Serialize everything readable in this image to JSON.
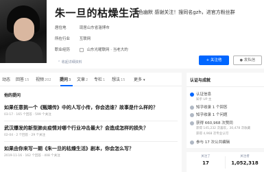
{
  "profile": {
    "name": "朱一旦的枯燥生活",
    "headline": "黑色幽默 感谢关注！搜同名gzh，进官方粉丝群",
    "rows": [
      {
        "key": "居住地",
        "value": "现居山东省淄博市"
      },
      {
        "key": "所在行业",
        "value": "互联网"
      },
      {
        "key": "职业经历",
        "value": "山东光曜联网 · 当老大的"
      }
    ],
    "collapse_label": "收起详细资料",
    "follow_label": "+ 关注他",
    "message_label": "发私信"
  },
  "tabs": [
    {
      "label": "动态",
      "count": ""
    },
    {
      "label": "回答",
      "count": "15"
    },
    {
      "label": "视频",
      "count": "202"
    },
    {
      "label": "提问",
      "count": "3"
    },
    {
      "label": "文章",
      "count": "2"
    },
    {
      "label": "专栏",
      "count": "1"
    },
    {
      "label": "想法",
      "count": "15"
    },
    {
      "label": "更多",
      "count": ""
    }
  ],
  "section_title": "他的提问",
  "questions": [
    {
      "title": "如果任意挑一个《甄嬛传》中的人写小传，你会选谁？故事是什么样的？",
      "meta": "03-17 · 165 个回答 · 599 个关注"
    },
    {
      "title": "武汉爆发的新型肺炎疫情对哪个行业冲击最大？会造成怎样的损失？",
      "meta": "02-04 · 2 个回答 · 29 个关注"
    },
    {
      "title": "如果由你来写一期《朱一旦的枯燥生活》剧本，你会怎么写？",
      "meta": "2019-11-16 · 162 个回答 · 408 个关注"
    }
  ],
  "sidebar": {
    "title": "认证与成就",
    "items": [
      {
        "label": "认证信息",
        "sub": "知乎 UP 主",
        "icon": "verified-icon"
      },
      {
        "label": "知乎收录 1 个回答",
        "sub": "",
        "icon": "collection-icon"
      },
      {
        "label": "知乎收录 1 个问题",
        "sub": "",
        "icon": "collection-icon"
      },
      {
        "label": "获得 660,968 次赞同",
        "sub": "获得 145,232 次喜欢，30,478 次收藏",
        "icon": "like-icon"
      },
      {
        "label": "",
        "sub": "获得 4,968 次专业认可",
        "icon": ""
      },
      {
        "label": "参与 17 次公共编辑",
        "sub": "",
        "icon": "edit-icon"
      }
    ]
  },
  "stats": {
    "following_label": "关注了",
    "following": "17",
    "followers_label": "关注者",
    "followers": "1,052,318"
  },
  "colors": {
    "accent": "#0066ff",
    "background": "#f6f6f6"
  }
}
